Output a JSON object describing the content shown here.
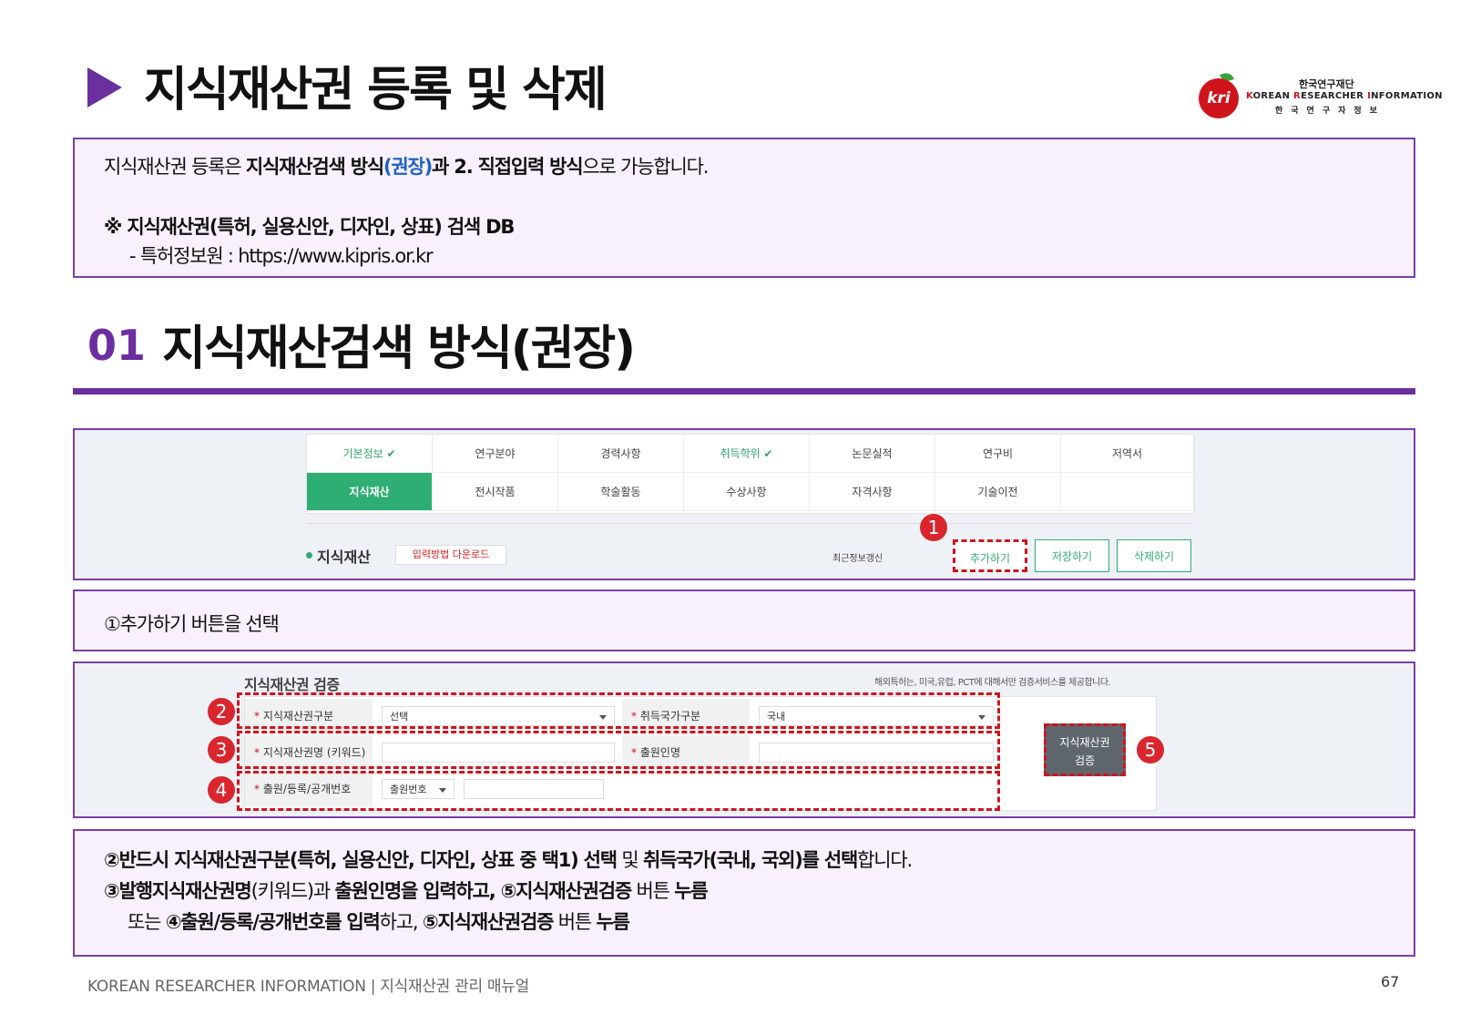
{
  "header": {
    "title": "지식재산권 등록 및 삭제"
  },
  "logo": {
    "circle_text": "kri",
    "ko_top": "한국연구재단",
    "en_k": "K",
    "en_orean": "OREAN ",
    "en_r": "R",
    "en_esearcher": "ESEARCHER ",
    "en_i": "I",
    "en_nformation": "NFORMATION",
    "ko_bottom": "한국연구자정보"
  },
  "info": {
    "line1_a": "지식재산권 등록은 ",
    "line1_b": "지식재산검색 방식",
    "line1_c": "(권장)",
    "line1_d": "과 2. 직접입력 방식",
    "line1_e": "으로 가능합니다.",
    "line2": "※ 지식재산권(특허, 실용신안, 디자인, 상표) 검색 DB",
    "line3": "- 특허정보원 : https://www.kipris.or.kr"
  },
  "section": {
    "number": "01",
    "title": "지식재산검색 방식(권장)"
  },
  "tabs_row1": [
    "기본정보 ✔",
    "연구분야",
    "경력사항",
    "취득학위 ✔",
    "논문실적",
    "연구비",
    "저역서"
  ],
  "tabs_row2": [
    "지식재산",
    "전시작품",
    "학술활동",
    "수상사항",
    "자격사항",
    "기술이전"
  ],
  "panel1": {
    "section_label": "지식재산",
    "download_btn": "입력방법 다운로드",
    "recent": "최근정보갱신",
    "add_btn": "추가하기",
    "save_btn": "저장하기",
    "delete_btn": "삭제하기",
    "badge": "1"
  },
  "step1": {
    "text": "①추가하기 버튼을 선택"
  },
  "panel2": {
    "title": "지식재산권 검증",
    "note": "해외특허는, 미국,유럽, PCT에 대해서만 검증서비스를 제공합니다.",
    "label_type": "지식재산권구분",
    "select_type": "선택",
    "label_country": "취득국가구분",
    "select_country": "국내",
    "label_name": "지식재산권명 (키워드)",
    "label_applicant": "출원인명",
    "label_number": "출원/등록/공개번호",
    "select_number": "출원번호",
    "verify_btn_1": "지식재산권",
    "verify_btn_2": "검증",
    "badge2": "2",
    "badge3": "3",
    "badge4": "4",
    "badge5": "5",
    "star": "*"
  },
  "step2": {
    "line1_a": "②반드시 ",
    "line1_b": "지식재산권구분(특허, 실용신안, 디자인, 상표 중 택1) 선택",
    "line1_c": " 및 ",
    "line1_d": "취득국가(국내, 국외)를 선택",
    "line1_e": "합니다.",
    "line2_a": "③",
    "line2_b": "발행지식재산권명",
    "line2_c": "(키워드)과 ",
    "line2_d": "출원인명을 입력하고, ⑤지식재산권검증",
    "line2_e": " 버튼 ",
    "line2_f": "누름",
    "line3_a": "또는 ",
    "line3_b": "④출원/등록/공개번호를 입력",
    "line3_c": "하고, ",
    "line3_d": "⑤지식재산권검증",
    "line3_e": " 버튼 ",
    "line3_f": "누름"
  },
  "footer": {
    "text": "KOREAN RESEARCHER INFORMATION  |  지식재산권 관리 매뉴얼",
    "page": "67"
  },
  "colors": {
    "accent": "#6b2fa0",
    "green": "#2fae73",
    "red": "#d0141c"
  }
}
